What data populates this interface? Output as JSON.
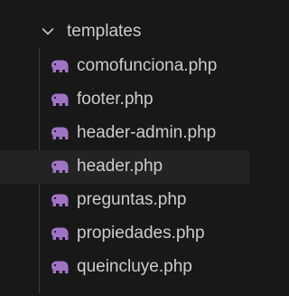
{
  "explorer": {
    "folder": {
      "label": "templates",
      "expanded": true,
      "chevron_icon": "chevron-down-icon"
    },
    "file_icon": "php-elephant-icon",
    "files": [
      {
        "label": "comofunciona.php"
      },
      {
        "label": "footer.php"
      },
      {
        "label": "header-admin.php"
      },
      {
        "label": "header.php"
      },
      {
        "label": "preguntas.php"
      },
      {
        "label": "propiedades.php"
      },
      {
        "label": "queincluye.php"
      }
    ]
  },
  "colors": {
    "background": "#181818",
    "text": "#cccccc",
    "php_icon": "#a074c4",
    "indent_guide": "#3c3c3c",
    "hover_row": "#232323"
  }
}
